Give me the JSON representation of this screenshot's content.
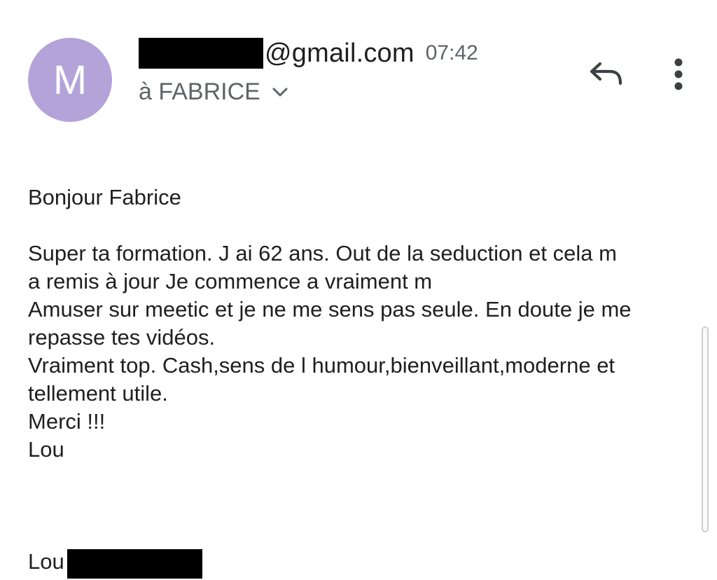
{
  "avatar": {
    "initial": "M",
    "color": "#b3a3d9"
  },
  "sender": {
    "domain": "@gmail.com",
    "time": "07:42"
  },
  "recipient": {
    "label": "à FABRICE"
  },
  "icons": {
    "recipient_expand": "chevron-down-icon",
    "reply": "reply-icon",
    "more": "more-vert-icon"
  },
  "message": {
    "body": "Bonjour Fabrice\n\nSuper ta formation. J ai 62 ans. Out de la seduction et cela m\na remis  à  jour   Je commence a vraiment m\nAmuser sur meetic et je ne me sens pas seule. En doute je me\nrepasse tes vidéos.\nVraiment top. Cash,sens de l humour,bienveillant,moderne  et\ntellement utile.\nMerci !!!\nLou",
    "signature_first": "Lou"
  }
}
